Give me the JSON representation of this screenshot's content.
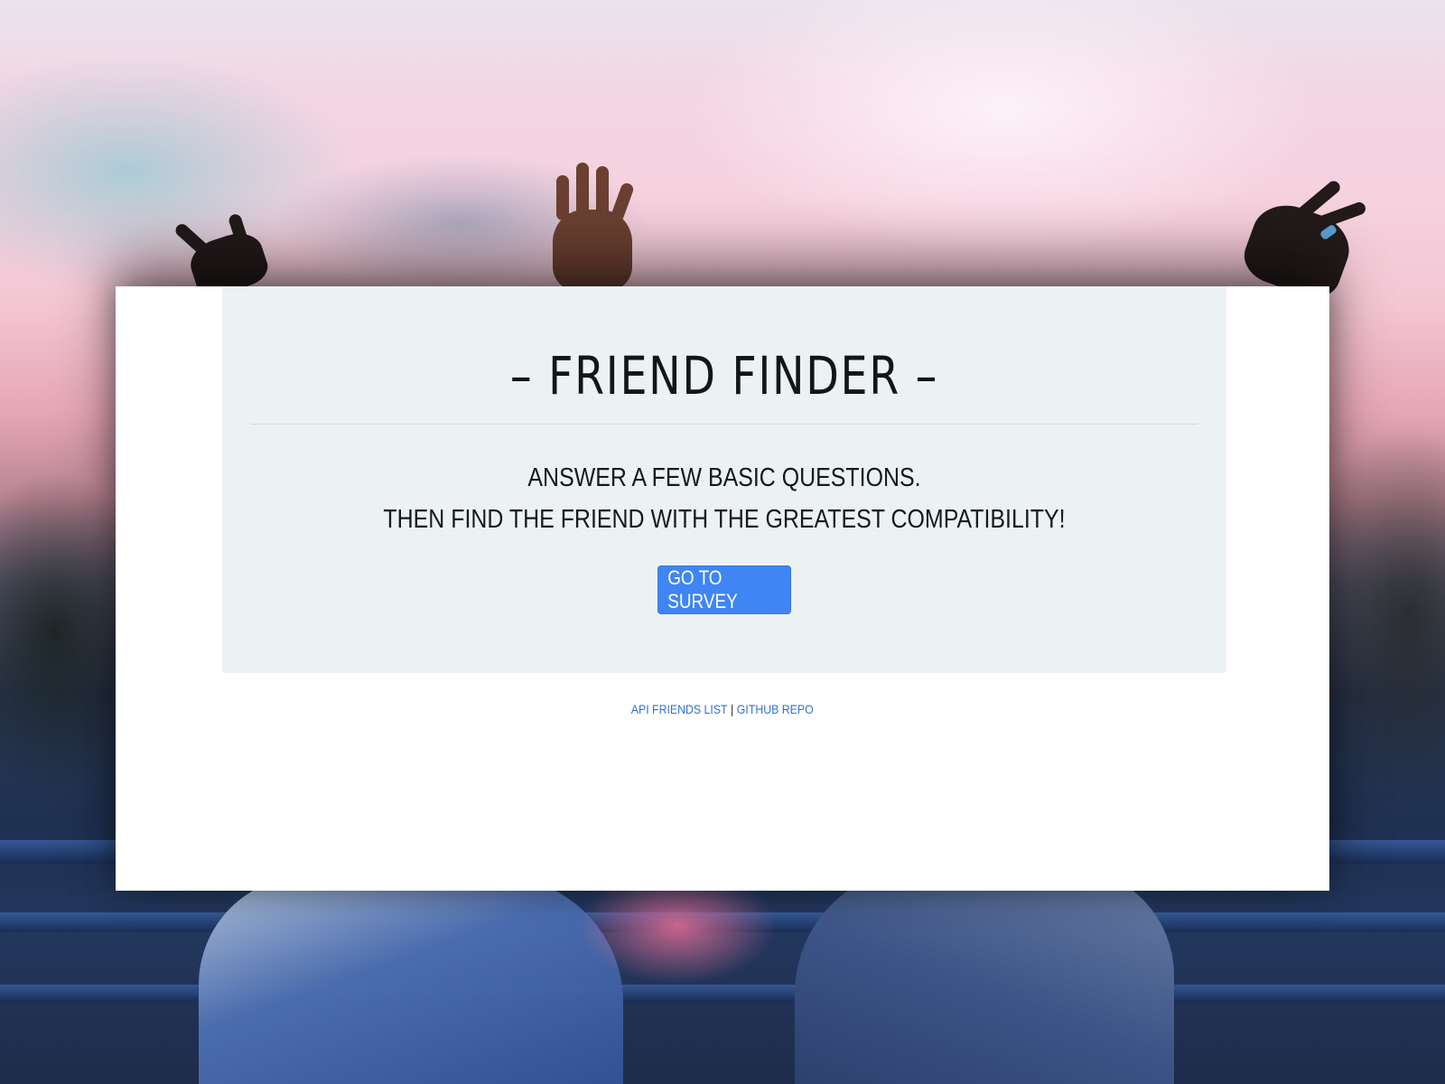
{
  "page": {
    "title": "– FRIEND FINDER –",
    "lead_line_1": "ANSWER A FEW BASIC QUESTIONS.",
    "lead_line_2": "THEN FIND THE FRIEND WITH THE GREATEST COMPATIBILITY!",
    "survey_button_label": "GO TO SURVEY"
  },
  "footer": {
    "links": [
      {
        "label": "API FRIENDS LIST"
      },
      {
        "label": "GITHUB REPO"
      }
    ],
    "separator": "|"
  },
  "colors": {
    "button": "#3f85f4",
    "jumbotron": "#ecf2f3",
    "link": "#2f74d0",
    "text": "#16191b"
  }
}
